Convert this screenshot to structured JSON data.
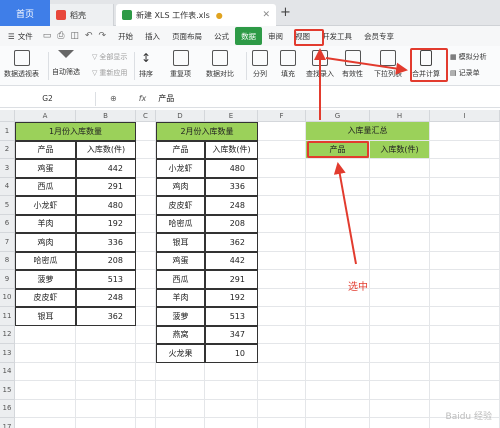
{
  "tabs": {
    "home": "首页",
    "shell": "稻壳",
    "doc": "新建 XLS 工作表.xls",
    "add": "+"
  },
  "menus": [
    "文件",
    "开始",
    "插入",
    "页面布局",
    "公式",
    "数据",
    "审阅",
    "视图",
    "开发工具",
    "会员专享"
  ],
  "ribbon": {
    "pivot": "数据透视表",
    "autofilter": "自动筛选",
    "showall": "全部显示",
    "reapply": "重新应用",
    "sort": "排序",
    "dup": "重复项",
    "compare": "数据对比",
    "split": "分列",
    "fill": "填充",
    "lookup": "查找录入",
    "validity": "有效性",
    "dropdown": "下拉列表",
    "consolidate": "合并计算",
    "whatif": "模拟分析",
    "record": "记录单"
  },
  "formula": {
    "namebox": "G2",
    "fx": "fx",
    "value": "产品"
  },
  "columns": [
    "A",
    "B",
    "C",
    "D",
    "E",
    "F",
    "G",
    "H",
    "I"
  ],
  "rows": [
    "1",
    "2",
    "3",
    "4",
    "5",
    "6",
    "7",
    "8",
    "9",
    "10",
    "11",
    "12",
    "13",
    "14",
    "15",
    "16",
    "17"
  ],
  "table1": {
    "title": "1月份入库数量",
    "headers": [
      "产品",
      "入库数(件)"
    ],
    "rows": [
      [
        "鸡蛋",
        "442"
      ],
      [
        "西瓜",
        "291"
      ],
      [
        "小龙虾",
        "480"
      ],
      [
        "羊肉",
        "192"
      ],
      [
        "鸡肉",
        "336"
      ],
      [
        "哈密瓜",
        "208"
      ],
      [
        "菠萝",
        "513"
      ],
      [
        "皮皮虾",
        "248"
      ],
      [
        "银耳",
        "362"
      ]
    ]
  },
  "table2": {
    "title": "2月份入库数量",
    "headers": [
      "产品",
      "入库数(件)"
    ],
    "rows": [
      [
        "小龙虾",
        "480"
      ],
      [
        "鸡肉",
        "336"
      ],
      [
        "皮皮虾",
        "248"
      ],
      [
        "哈密瓜",
        "208"
      ],
      [
        "银耳",
        "362"
      ],
      [
        "鸡蛋",
        "442"
      ],
      [
        "西瓜",
        "291"
      ],
      [
        "羊肉",
        "192"
      ],
      [
        "菠萝",
        "513"
      ],
      [
        "燕窝",
        "347"
      ],
      [
        "火龙果",
        "10"
      ]
    ]
  },
  "summary": {
    "title": "入库量汇总",
    "headers": [
      "产品",
      "入库数(件)"
    ]
  },
  "annotation": "选中",
  "watermark": "Baidu 经验"
}
